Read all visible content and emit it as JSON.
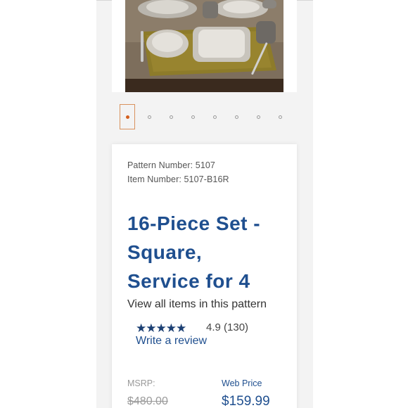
{
  "product": {
    "pattern_number": "Pattern Number: 5107",
    "item_number": "Item Number: 5107-B16R",
    "title_lines": [
      "16-Piece Set -",
      "Square,",
      "Service for 4"
    ],
    "view_all_link": "View all items in this pattern",
    "rating": {
      "stars": "★★★★★",
      "value": "4.9",
      "count": "(130)",
      "score": 4.9
    },
    "write_review": "Write a review",
    "msrp_label": "MSRP:",
    "msrp_value": "$480.00",
    "web_price_label": "Web Price",
    "web_price_value": "$159.99"
  },
  "gallery": {
    "slide_count": 8,
    "active_index": 0
  },
  "colors": {
    "brand_blue": "#1f4f8f",
    "star_navy": "#1b3f73",
    "active_dot": "#d4601e"
  }
}
